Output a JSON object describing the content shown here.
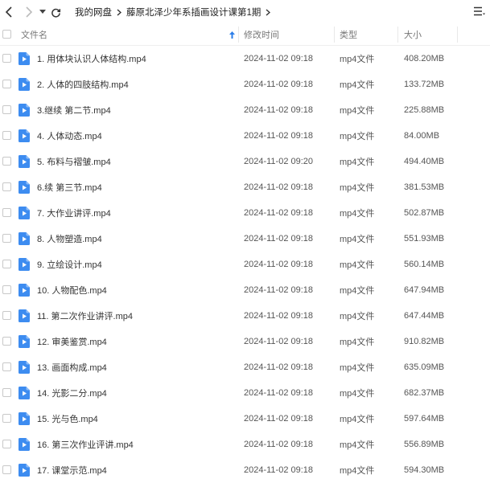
{
  "toolbar": {
    "back_icon": "chevron-left-icon",
    "forward_icon": "chevron-right-icon",
    "dropdown_icon": "caret-down-icon",
    "refresh_icon": "refresh-icon",
    "menu_icon": "list-menu-icon"
  },
  "breadcrumb": {
    "root": "我的网盘",
    "current": "藤原北泽少年系插画设计课第1期"
  },
  "table": {
    "headers": {
      "name": "文件名",
      "modified": "修改时间",
      "type": "类型",
      "size": "大小"
    },
    "sort_icon": "sort-up-arrow-icon",
    "rows": [
      {
        "name": "1. 用体块认识人体结构.mp4",
        "modified": "2024-11-02 09:18",
        "type": "mp4文件",
        "size": "408.20MB"
      },
      {
        "name": "2. 人体的四肢结构.mp4",
        "modified": "2024-11-02 09:18",
        "type": "mp4文件",
        "size": "133.72MB"
      },
      {
        "name": "3.继续 第二节.mp4",
        "modified": "2024-11-02 09:18",
        "type": "mp4文件",
        "size": "225.88MB"
      },
      {
        "name": "4. 人体动态.mp4",
        "modified": "2024-11-02 09:18",
        "type": "mp4文件",
        "size": "84.00MB"
      },
      {
        "name": "5. 布料与褶皱.mp4",
        "modified": "2024-11-02 09:20",
        "type": "mp4文件",
        "size": "494.40MB"
      },
      {
        "name": "6.续 第三节.mp4",
        "modified": "2024-11-02 09:18",
        "type": "mp4文件",
        "size": "381.53MB"
      },
      {
        "name": "7. 大作业讲评.mp4",
        "modified": "2024-11-02 09:18",
        "type": "mp4文件",
        "size": "502.87MB"
      },
      {
        "name": "8. 人物塑造.mp4",
        "modified": "2024-11-02 09:18",
        "type": "mp4文件",
        "size": "551.93MB"
      },
      {
        "name": "9. 立绘设计.mp4",
        "modified": "2024-11-02 09:18",
        "type": "mp4文件",
        "size": "560.14MB"
      },
      {
        "name": "10. 人物配色.mp4",
        "modified": "2024-11-02 09:18",
        "type": "mp4文件",
        "size": "647.94MB"
      },
      {
        "name": "11. 第二次作业讲评.mp4",
        "modified": "2024-11-02 09:18",
        "type": "mp4文件",
        "size": "647.44MB"
      },
      {
        "name": "12. 审美鉴赏.mp4",
        "modified": "2024-11-02 09:18",
        "type": "mp4文件",
        "size": "910.82MB"
      },
      {
        "name": "13. 画面构成.mp4",
        "modified": "2024-11-02 09:18",
        "type": "mp4文件",
        "size": "635.09MB"
      },
      {
        "name": "14. 光影二分.mp4",
        "modified": "2024-11-02 09:18",
        "type": "mp4文件",
        "size": "682.37MB"
      },
      {
        "name": "15. 光与色.mp4",
        "modified": "2024-11-02 09:18",
        "type": "mp4文件",
        "size": "597.64MB"
      },
      {
        "name": "16. 第三次作业评讲.mp4",
        "modified": "2024-11-02 09:18",
        "type": "mp4文件",
        "size": "556.89MB"
      },
      {
        "name": "17. 课堂示范.mp4",
        "modified": "2024-11-02 09:18",
        "type": "mp4文件",
        "size": "594.30MB"
      }
    ]
  },
  "colors": {
    "file_icon": "#3d8cf0",
    "accent": "#2b7de9",
    "divider": "#eeeeee"
  }
}
